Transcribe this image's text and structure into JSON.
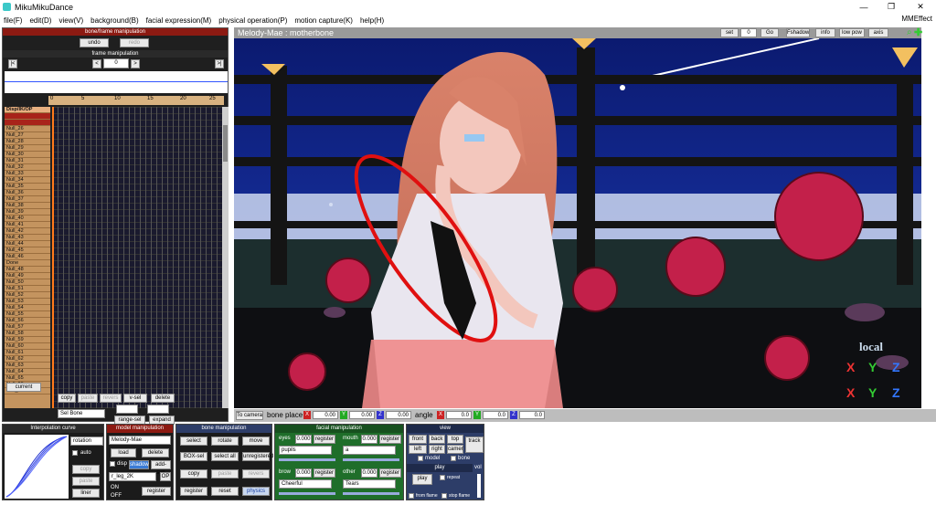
{
  "titlebar": {
    "app_title": "MikuMikuDance",
    "min": "—",
    "max": "❐",
    "close": "✕"
  },
  "menu": [
    "file(F)",
    "edit(D)",
    "view(V)",
    "background(B)",
    "facial expression(M)",
    "physical operation(P)",
    "motion capture(K)",
    "help(H)"
  ],
  "menu_right": "MMEffect",
  "bone_frame": {
    "header": "bone/frame manipulation",
    "undo": "undo",
    "redo": "redo",
    "frame_header": "frame manipulation",
    "frame_value": "0",
    "first": "|<",
    "prev": "<",
    "next": ">",
    "last": ">|"
  },
  "ruler_ticks": [
    "0",
    "5",
    "10",
    "15",
    "20",
    "25"
  ],
  "tracks": [
    "Disp/IK/OP",
    "",
    "",
    "Null_26",
    "Null_27",
    "Null_28",
    "Null_29",
    "Null_30",
    "Null_31",
    "Null_32",
    "Null_33",
    "Null_34",
    "Null_35",
    "Null_36",
    "Null_37",
    "Null_38",
    "Null_39",
    "Null_40",
    "Null_41",
    "Null_42",
    "Null_43",
    "Null_44",
    "Null_45",
    "Null_46",
    "Done",
    "Null_48",
    "Null_49",
    "Null_50",
    "Null_51",
    "Null_52",
    "Null_53",
    "Null_54",
    "Null_55",
    "Null_56",
    "Null_57",
    "Null_58",
    "Null_59",
    "Null_60",
    "Null_61",
    "Null_62",
    "Null_63",
    "Null_64",
    "Null_65",
    "Null_66",
    "Null_67"
  ],
  "tl_buttons": {
    "current": "current",
    "copy": "copy",
    "paste": "paste",
    "reverse": "revers",
    "vsel": "v-sel",
    "delete": "delete",
    "sel_bone": "Sel Bone",
    "range_sel": "range-sel",
    "expand": "expand"
  },
  "viewport": {
    "title": "Melody-Mae : motherbone",
    "set": "set",
    "set_value": "0",
    "go": "Go",
    "fshadow": "Fshadow",
    "info": "info",
    "lowpow": "low pow",
    "axis": "axis",
    "local": "local",
    "gx": "Y",
    "gy": "Y",
    "gz": "Z",
    "ax": "X",
    "ay": "Y",
    "az": "Z"
  },
  "vp_bottom": {
    "to_camera": "To camera",
    "bone_place": "bone place",
    "x": "X",
    "y": "Y",
    "z": "Z",
    "px": "0.00",
    "py": "0.00",
    "pz": "0.00",
    "angle": "angle",
    "rx": "0.0",
    "ry": "0.0",
    "rz": "0.0"
  },
  "interp": {
    "header": "Interpolation curve",
    "mode": "rotation",
    "auto": "auto",
    "copy": "copy",
    "paste": "paste",
    "liner": "liner"
  },
  "model": {
    "header": "model manipulation",
    "name": "Melody-Mae",
    "load": "load",
    "delete": "delete",
    "disp": "disp",
    "shadow": "shadow",
    "add_syn": "add-syn",
    "bone_sel": "r_leg_2K",
    "op": "OP",
    "on": "ON",
    "off": "OFF",
    "register": "register"
  },
  "bone": {
    "header": "bone manipulation",
    "select": "select",
    "rotate": "rotate",
    "move": "move",
    "boxsel": "BOX-sel",
    "select_all": "select all",
    "unregistered": "unregistered",
    "copy": "copy",
    "paste": "paste",
    "reverse": "revers",
    "register": "register",
    "reset": "reset",
    "physics": "physics"
  },
  "facial": {
    "header": "facial manipulation",
    "eyes": "eyes",
    "eyes_val": "0.000",
    "eyes_sel": "pupils",
    "mouth": "mouth",
    "mouth_val": "0.000",
    "mouth_sel": "a",
    "brow": "brow",
    "brow_val": "0.000",
    "brow_sel": "Cheerful",
    "other": "other",
    "other_val": "0.000",
    "other_sel": "Tears",
    "register": "register"
  },
  "view": {
    "header": "view",
    "front": "front",
    "back": "back",
    "top": "top",
    "track": "track",
    "left": "left",
    "right": "right",
    "camera": "camer",
    "model": "model",
    "bone": "bone"
  },
  "play": {
    "header": "play",
    "play": "play",
    "repeat": "repeat",
    "vol": "vol",
    "from_frame": "from flame",
    "stop_frame": "stop flame"
  },
  "colors": {
    "accent_red": "#8c1a12",
    "sky": "#0a1a6e",
    "facial_green": "#1f6e2a",
    "view_blue": "#2d3d68"
  }
}
